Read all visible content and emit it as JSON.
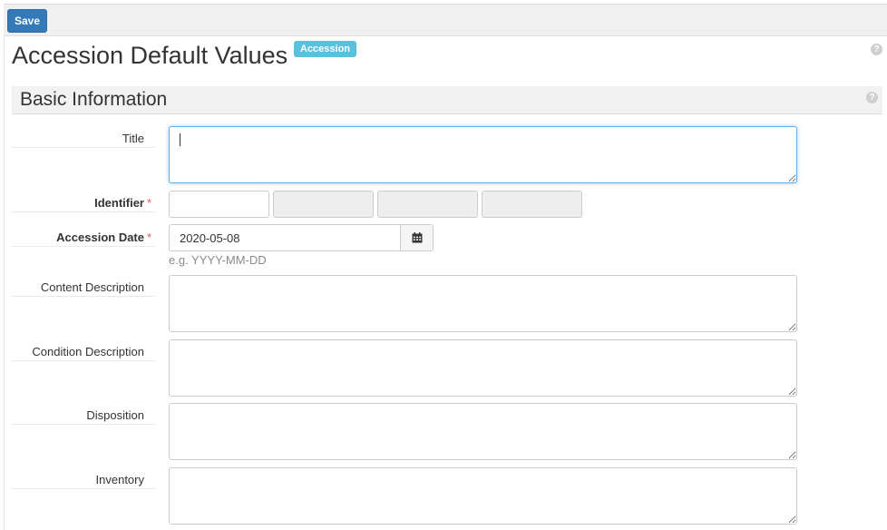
{
  "toolbar": {
    "save_label": "Save"
  },
  "page": {
    "title": "Accession Default Values",
    "badge": "Accession",
    "help_glyph": "?"
  },
  "section": {
    "title": "Basic Information",
    "help_glyph": "?"
  },
  "fields": {
    "title": {
      "label": "Title",
      "value": ""
    },
    "identifier": {
      "label": "Identifier",
      "required_mark": "*",
      "parts": [
        "",
        "",
        "",
        ""
      ]
    },
    "accession_date": {
      "label": "Accession Date",
      "required_mark": "*",
      "value": "2020-05-08",
      "hint": "e.g. YYYY-MM-DD"
    },
    "content_description": {
      "label": "Content Description",
      "value": ""
    },
    "condition_description": {
      "label": "Condition Description",
      "value": ""
    },
    "disposition": {
      "label": "Disposition",
      "value": ""
    },
    "inventory": {
      "label": "Inventory",
      "value": ""
    }
  },
  "icons": {
    "help": "question-circle-icon",
    "calendar": "calendar-icon"
  },
  "colors": {
    "primary": "#337ab7",
    "badge": "#5bc0de",
    "required": "#e25c5c",
    "focus": "#66afe9"
  }
}
